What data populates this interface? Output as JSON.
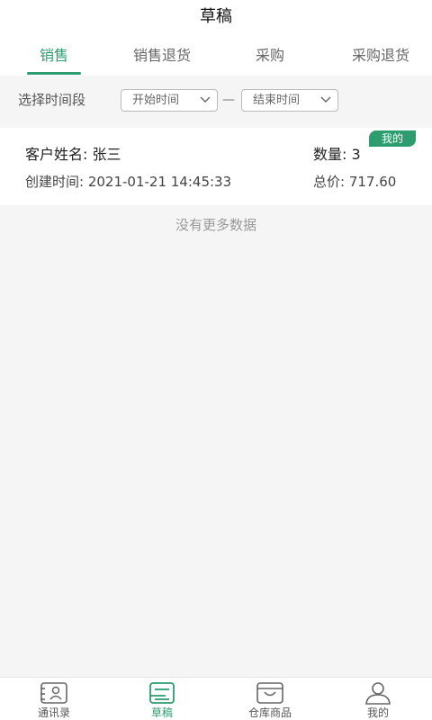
{
  "header": {
    "title": "草稿"
  },
  "tabs": [
    {
      "label": "销售"
    },
    {
      "label": "销售退货"
    },
    {
      "label": "采购"
    },
    {
      "label": "采购退货"
    }
  ],
  "filter": {
    "label": "选择时间段",
    "start": "开始时间",
    "separator": "—",
    "end": "结束时间"
  },
  "record": {
    "badge": "我的",
    "customer": "客户姓名: 张三",
    "quantity": "数量: 3",
    "created": "创建时间: 2021-01-21 14:45:33",
    "total": "总价: 717.60"
  },
  "no_more": "没有更多数据",
  "nav": [
    {
      "label": "通讯录",
      "icon": "contacts-icon"
    },
    {
      "label": "草稿",
      "icon": "drafts-icon"
    },
    {
      "label": "仓库商品",
      "icon": "warehouse-icon"
    },
    {
      "label": "我的",
      "icon": "profile-icon"
    }
  ],
  "colors": {
    "accent": "#2d9c6f"
  }
}
